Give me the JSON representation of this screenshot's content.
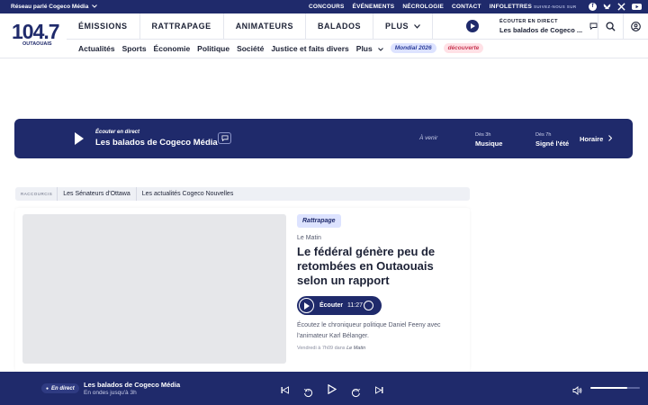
{
  "topbar": {
    "network": "Réseau parlé Cogeco Média",
    "links": [
      "CONCOURS",
      "ÉVÉNEMENTS",
      "NÉCROLOGIE",
      "CONTACT",
      "INFOLETTRES"
    ],
    "follow": "SUIVEZ-NOUS SUR",
    "social": [
      "facebook-icon",
      "bluesky-icon",
      "x-icon",
      "youtube-icon"
    ]
  },
  "logo": {
    "number": "104.7",
    "region": "OUTAOUAIS"
  },
  "mainnav": [
    "ÉMISSIONS",
    "RATTRAPAGE",
    "ANIMATEURS",
    "BALADOS"
  ],
  "mainnav_more": "PLUS",
  "live_mini": {
    "label": "ÉCOUTER EN DIRECT",
    "show": "Les balados de Cogeco ..."
  },
  "subnav": [
    "Actualités",
    "Sports",
    "Économie",
    "Politique",
    "Société",
    "Justice et faits divers"
  ],
  "subnav_more": "Plus",
  "subnav_pills": [
    "Mondial 2026",
    "découverte"
  ],
  "banner": {
    "label": "Écouter en direct",
    "show": "Les balados de Cogeco Média",
    "upcoming_label": "À venir",
    "slots": [
      {
        "time": "Dès 3h",
        "name": "Musique"
      },
      {
        "time": "Dès 7h",
        "name": "Signé l'été"
      }
    ],
    "schedule": "Horaire"
  },
  "shortcuts": {
    "label": "RACCOURCIS",
    "items": [
      "Les Sénateurs d'Ottawa",
      "Les actualités Cogeco Nouvelles"
    ]
  },
  "article": {
    "tag": "Rattrapage",
    "show": "Le Matin",
    "headline": "Le fédéral génère peu de retombées en Outaouais selon un rapport",
    "listen_label": "Écouter",
    "duration": "11:27",
    "description": "Écoutez le chroniqueur politique Daniel Feeny avec l'animateur Karl Bélanger.",
    "meta_prefix": "Vendredi à 7h09 dans",
    "meta_show": "Le Matin"
  },
  "player": {
    "live": "En direct",
    "title": "Les balados de Cogeco Média",
    "subtitle": "En ondes jusqu'à 3h",
    "rewind": "15",
    "forward": "15",
    "volume": 0.75
  },
  "colors": {
    "brand": "#1f2a6b",
    "pill_blue": "#dde3ff",
    "pill_pink": "#ffe1e6"
  }
}
